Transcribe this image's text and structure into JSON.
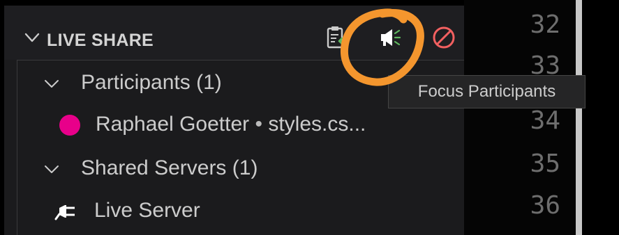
{
  "panel": {
    "title": "LIVE SHARE",
    "actions": [
      {
        "icon": "clipboard-arrow-icon",
        "color": "#cccccc"
      },
      {
        "icon": "megaphone-icon",
        "color": "#ffffff",
        "accent": "#5fb85f"
      },
      {
        "icon": "no-entry-icon",
        "color": "#f26060"
      }
    ]
  },
  "tree": {
    "participants": {
      "label": "Participants (1)",
      "items": [
        {
          "name": "Raphael Goetter",
          "separator": "•",
          "file": "styles.cs...",
          "color": "#e8008a"
        }
      ]
    },
    "servers": {
      "label": "Shared Servers (1)",
      "items": [
        {
          "label": "Live Server",
          "icon": "plug-icon"
        }
      ]
    }
  },
  "tooltip": {
    "text": "Focus Participants"
  },
  "editor": {
    "line_numbers": [
      "32",
      "33",
      "34",
      "35",
      "36"
    ]
  },
  "annotation": {
    "color": "#f4962e"
  }
}
